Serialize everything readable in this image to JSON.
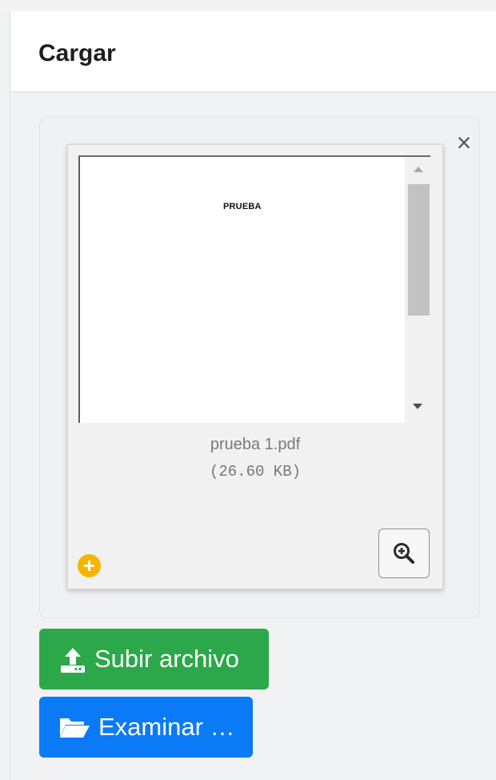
{
  "panel": {
    "title": "Cargar"
  },
  "file_preview": {
    "document_text": "PRUEBA",
    "file_name": "prueba 1.pdf",
    "file_size": "(26.60 KB)"
  },
  "buttons": {
    "upload_label": "Subir archivo",
    "browse_label": "Examinar …"
  },
  "icons": {
    "close": "close-icon",
    "add": "plus-circle-icon",
    "zoom": "zoom-in-icon",
    "upload": "upload-icon",
    "browse": "folder-open-icon"
  },
  "colors": {
    "upload_button": "#2ca84a",
    "browse_button": "#0a7af7",
    "add_icon": "#f4b400"
  }
}
